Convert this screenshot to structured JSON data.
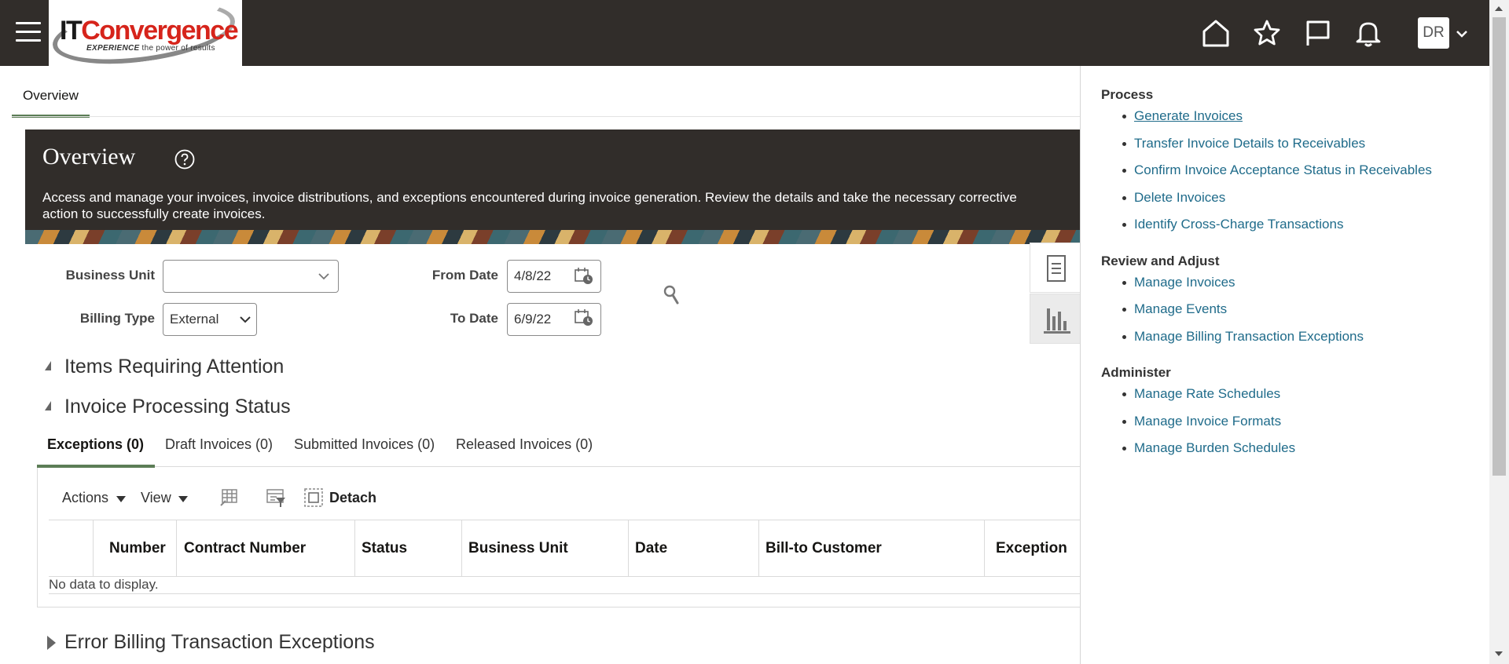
{
  "header": {
    "brand_it": "IT",
    "brand_convergence": "Convergence",
    "tagline_bold": "EXPERIENCE",
    "tagline_rest": " the power of results",
    "user_initials": "DR",
    "icons": [
      "hamburger-menu-icon",
      "home-icon",
      "star-icon",
      "flag-icon",
      "bell-icon",
      "chevron-down-icon"
    ]
  },
  "tabs": {
    "overview": "Overview"
  },
  "banner": {
    "title": "Overview",
    "description": "Access and manage your invoices, invoice distributions, and exceptions encountered during invoice generation. Review the details and take the necessary corrective action to successfully create invoices."
  },
  "filters": {
    "business_unit_label": "Business Unit",
    "business_unit_value": "",
    "billing_type_label": "Billing Type",
    "billing_type_value": "External",
    "from_date_label": "From Date",
    "from_date_value": "4/8/22",
    "to_date_label": "To Date",
    "to_date_value": "6/9/22"
  },
  "sections": {
    "items_requiring_attention": "Items Requiring Attention",
    "invoice_processing_status": "Invoice Processing Status",
    "error_billing": "Error Billing Transaction Exceptions"
  },
  "subtabs": {
    "exceptions": "Exceptions (0)",
    "draft": "Draft Invoices (0)",
    "submitted": "Submitted Invoices (0)",
    "released": "Released Invoices (0)"
  },
  "toolbar": {
    "actions": "Actions",
    "view": "View",
    "detach": "Detach"
  },
  "table": {
    "columns": [
      "Number",
      "Contract Number",
      "Status",
      "Business Unit",
      "Date",
      "Bill-to Customer",
      "Exception"
    ],
    "empty_text": "No data to display."
  },
  "tasks": {
    "process_heading": "Process",
    "process_links": [
      "Generate Invoices",
      "Transfer Invoice Details to Receivables",
      "Confirm Invoice Acceptance Status in Receivables",
      "Delete Invoices",
      "Identify Cross-Charge Transactions"
    ],
    "review_heading": "Review and Adjust",
    "review_links": [
      "Manage Invoices",
      "Manage Events",
      "Manage Billing Transaction Exceptions"
    ],
    "administer_heading": "Administer",
    "administer_links": [
      "Manage Rate Schedules",
      "Manage Invoice Formats",
      "Manage Burden Schedules"
    ]
  },
  "colors": {
    "header_bg": "#312d2a",
    "accent_green": "#5c7d56",
    "link_blue": "#1f6b8a",
    "brand_red": "#d6241b"
  }
}
